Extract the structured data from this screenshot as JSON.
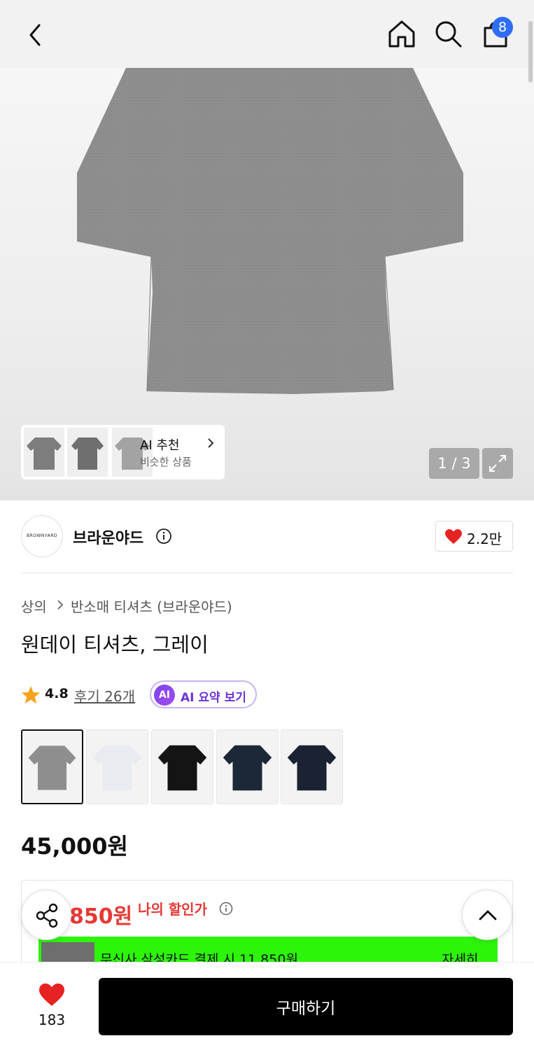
{
  "header": {
    "icons": [
      "back-icon",
      "home-icon",
      "search-icon",
      "shopping-bag-icon"
    ],
    "cart_count": "8"
  },
  "gallery": {
    "page_indicator": "1 / 3",
    "ai_reco": {
      "title": "AI 추천",
      "subtitle": "비슷한 상품"
    }
  },
  "brand": {
    "logo_text": "BROWNYARD",
    "name": "브라운야드",
    "like_count": "2.2만"
  },
  "breadcrumb": {
    "level1": "상의",
    "level2": "반소매 티셔츠 (브라운야드)"
  },
  "product": {
    "title": "원데이 티셔츠, 그레이",
    "rating": "4.8",
    "reviews": "후기 26개",
    "ai_summary": {
      "badge": "AI",
      "label": "AI 요약 보기"
    },
    "colors": [
      "#8e8e8e",
      "#e8ebef",
      "#141414",
      "#1c2838",
      "#1a2234"
    ],
    "price": "45,000원"
  },
  "discount": {
    "price": "850원",
    "label": "나의 할인가",
    "promo_text": "무신사 삼성카드 결제 시 11,850원",
    "promo_more": "자세히"
  },
  "bottom_bar": {
    "like_count": "183",
    "buy_label": "구매하기"
  },
  "colors": {
    "accent_blue": "#2f6df6",
    "heart_red": "#e62222",
    "discount_red": "#e53935",
    "promo_green": "#2cf50a"
  }
}
